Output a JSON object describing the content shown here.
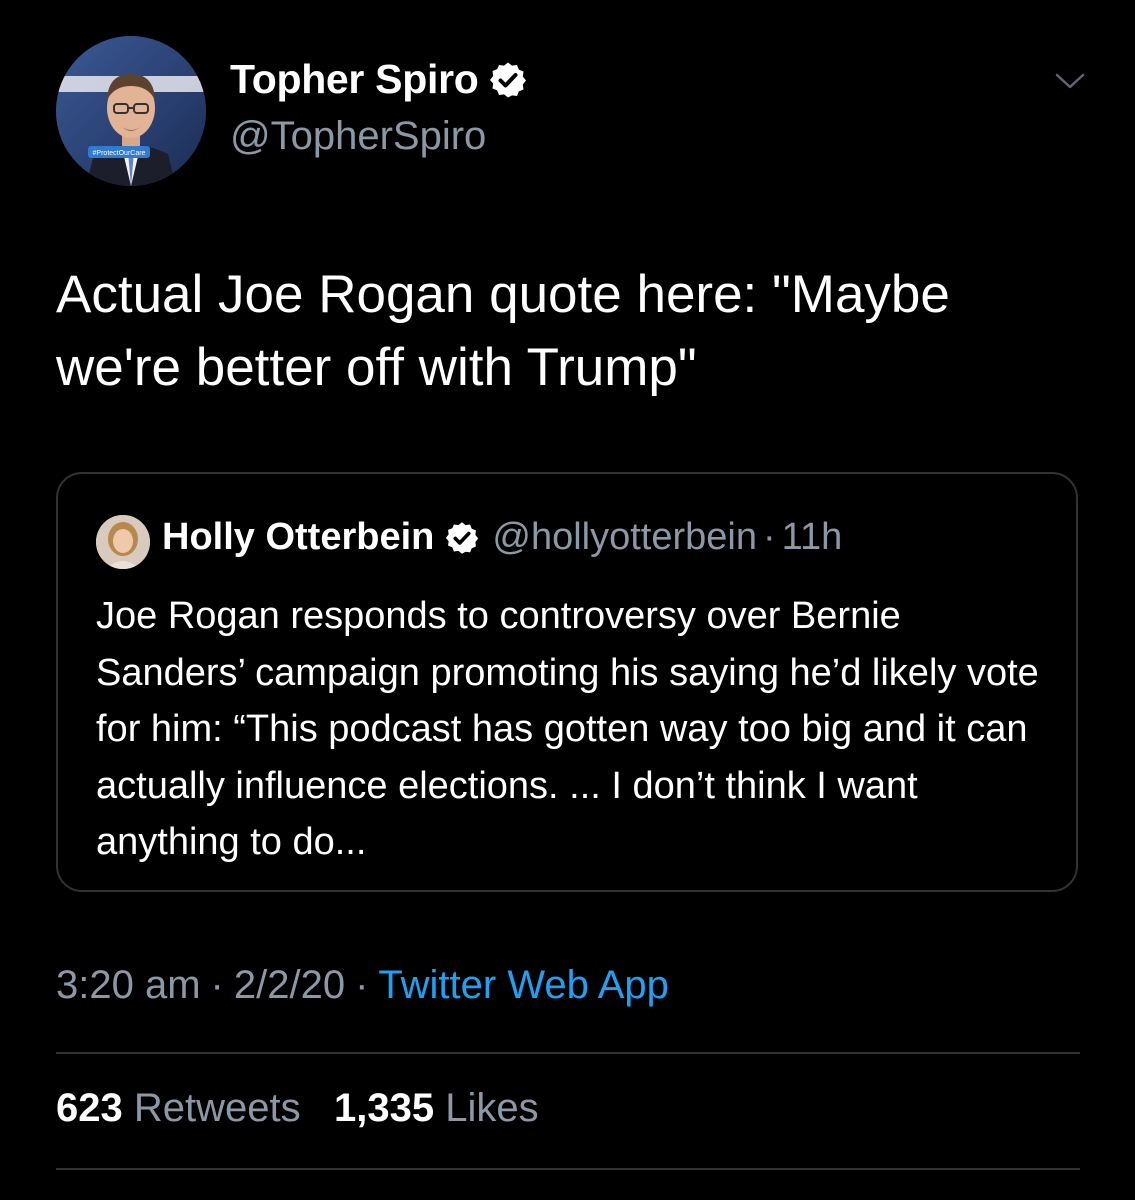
{
  "tweet": {
    "author_name": "Topher Spiro",
    "author_handle": "@TopherSpiro",
    "avatar_banner": "#ProtectOurCare",
    "text": "Actual Joe Rogan quote here: \"Maybe we're better off with Trump\"",
    "time": "3:20 am",
    "date": "2/2/20",
    "separator": "·",
    "source": "Twitter Web App"
  },
  "quoted_tweet": {
    "author_name": "Holly Otterbein",
    "author_handle": "@hollyotterbein",
    "separator": "·",
    "time_ago": "11h",
    "text": "Joe Rogan responds to controversy over Bernie Sanders’ campaign promoting his saying he’d likely vote for him: “This podcast has gotten way too big and it can actually influence elections. ... I don’t think I want anything to do..."
  },
  "stats": {
    "retweets_count": "623",
    "retweets_label": "Retweets",
    "likes_count": "1,335",
    "likes_label": "Likes"
  },
  "icons": {
    "verified": "verified-badge-icon",
    "menu": "chevron-down-icon"
  },
  "colors": {
    "background": "#000000",
    "text": "#ffffff",
    "secondary": "#8b98a5",
    "link": "#1da1f2",
    "border": "#2f3336"
  }
}
